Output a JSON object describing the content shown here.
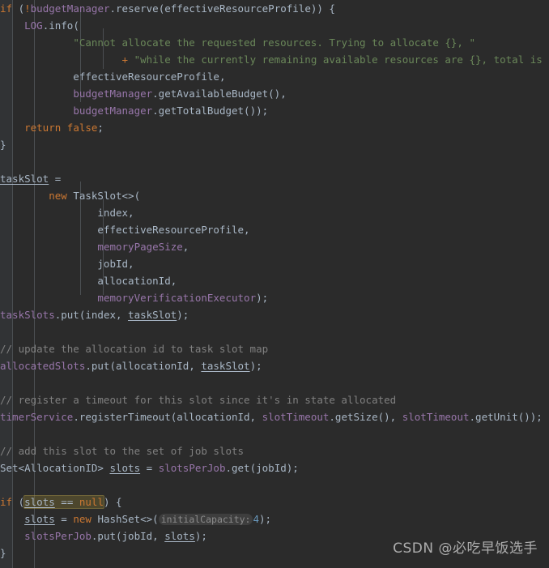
{
  "editor": {
    "background_color": "#2b2b2b",
    "gutter_color": "#313335",
    "default_text_color": "#a9b7c6",
    "font_size_px": 12.5,
    "line_height_px": 21,
    "colors": {
      "keyword": "#cc7832",
      "field": "#9876aa",
      "string": "#6a8759",
      "comment": "#808080",
      "number": "#6897bb",
      "identifier": "#a9b7c6",
      "highlight_box": "rgba(150,130,50,0.32)",
      "inlay_hint": "#8c8c8c"
    }
  },
  "code": {
    "lines": [
      {
        "id": "line-if-budget-reserve",
        "clipped_top": true,
        "tokens": [
          {
            "t": "if",
            "c": "kw"
          },
          {
            "t": " (",
            "c": "plain"
          },
          {
            "t": "!",
            "c": "kw"
          },
          {
            "t": "budgetManager",
            "c": "field"
          },
          {
            "t": ".reserve(effectiveResourceProfile)) {",
            "c": "plain"
          }
        ]
      },
      {
        "id": "line-log-info",
        "tokens": [
          {
            "t": "    ",
            "c": "plain"
          },
          {
            "t": "LOG",
            "c": "field"
          },
          {
            "t": ".info(",
            "c": "plain"
          }
        ]
      },
      {
        "id": "line-string-cannot-allocate",
        "tokens": [
          {
            "t": "            ",
            "c": "plain"
          },
          {
            "t": "\"Cannot allocate the requested resources. Trying to allocate {}, \"",
            "c": "str"
          }
        ]
      },
      {
        "id": "line-string-while-remaining",
        "tokens": [
          {
            "t": "                    ",
            "c": "plain"
          },
          {
            "t": "+ ",
            "c": "kw"
          },
          {
            "t": "\"while the currently remaining available resources are {}, total is ",
            "c": "str"
          }
        ]
      },
      {
        "id": "line-arg-effective-resource-profile",
        "tokens": [
          {
            "t": "            effectiveResourceProfile",
            "c": "plain"
          },
          {
            "t": ",",
            "c": "plain"
          }
        ]
      },
      {
        "id": "line-arg-get-available-budget",
        "tokens": [
          {
            "t": "            ",
            "c": "plain"
          },
          {
            "t": "budgetManager",
            "c": "field"
          },
          {
            "t": ".getAvailableBudget(),",
            "c": "plain"
          }
        ]
      },
      {
        "id": "line-arg-get-total-budget",
        "tokens": [
          {
            "t": "            ",
            "c": "plain"
          },
          {
            "t": "budgetManager",
            "c": "field"
          },
          {
            "t": ".getTotalBudget());",
            "c": "plain"
          }
        ]
      },
      {
        "id": "line-return-false",
        "tokens": [
          {
            "t": "    ",
            "c": "plain"
          },
          {
            "t": "return false",
            "c": "kw"
          },
          {
            "t": ";",
            "c": "plain"
          }
        ]
      },
      {
        "id": "line-close-brace-1",
        "tokens": [
          {
            "t": "}",
            "c": "plain"
          }
        ]
      },
      {
        "id": "line-blank-1",
        "tokens": []
      },
      {
        "id": "line-taskslot-assign",
        "tokens": [
          {
            "t": "taskSlot",
            "c": "localvar"
          },
          {
            "t": " =",
            "c": "plain"
          }
        ]
      },
      {
        "id": "line-new-taskslot",
        "tokens": [
          {
            "t": "        ",
            "c": "plain"
          },
          {
            "t": "new ",
            "c": "kw"
          },
          {
            "t": "TaskSlot<>(",
            "c": "cls"
          }
        ]
      },
      {
        "id": "line-ctor-index",
        "tokens": [
          {
            "t": "                index",
            "c": "plain"
          },
          {
            "t": ",",
            "c": "plain"
          }
        ]
      },
      {
        "id": "line-ctor-effective-resource-profile",
        "tokens": [
          {
            "t": "                effectiveResourceProfile,",
            "c": "plain"
          }
        ]
      },
      {
        "id": "line-ctor-memory-page-size",
        "tokens": [
          {
            "t": "                ",
            "c": "plain"
          },
          {
            "t": "memoryPageSize",
            "c": "field"
          },
          {
            "t": ",",
            "c": "plain"
          }
        ]
      },
      {
        "id": "line-ctor-jobid",
        "tokens": [
          {
            "t": "                jobId",
            "c": "plain"
          },
          {
            "t": ",",
            "c": "plain"
          }
        ]
      },
      {
        "id": "line-ctor-allocationid",
        "tokens": [
          {
            "t": "                allocationId,",
            "c": "plain"
          }
        ]
      },
      {
        "id": "line-ctor-memory-verification-executor",
        "tokens": [
          {
            "t": "                ",
            "c": "plain"
          },
          {
            "t": "memoryVerificationExecutor",
            "c": "field"
          },
          {
            "t": ");",
            "c": "plain"
          }
        ]
      },
      {
        "id": "line-taskslots-put",
        "tokens": [
          {
            "t": "taskSlots",
            "c": "field"
          },
          {
            "t": ".put(index, ",
            "c": "plain"
          },
          {
            "t": "taskSlot",
            "c": "localvar"
          },
          {
            "t": ");",
            "c": "plain"
          }
        ]
      },
      {
        "id": "line-blank-2",
        "tokens": []
      },
      {
        "id": "line-comment-update-allocation",
        "tokens": [
          {
            "t": "// update the allocation id to task slot map",
            "c": "cmt"
          }
        ]
      },
      {
        "id": "line-allocatedslots-put",
        "tokens": [
          {
            "t": "allocatedSlots",
            "c": "field"
          },
          {
            "t": ".put(allocationId, ",
            "c": "plain"
          },
          {
            "t": "taskSlot",
            "c": "localvar"
          },
          {
            "t": ");",
            "c": "plain"
          }
        ]
      },
      {
        "id": "line-blank-3",
        "tokens": []
      },
      {
        "id": "line-comment-register-timeout",
        "tokens": [
          {
            "t": "// register a timeout for this slot since it's in state allocated",
            "c": "cmt"
          }
        ]
      },
      {
        "id": "line-timerservice-register-timeout",
        "tokens": [
          {
            "t": "timerService",
            "c": "field"
          },
          {
            "t": ".registerTimeout(allocationId, ",
            "c": "plain"
          },
          {
            "t": "slotTimeout",
            "c": "field"
          },
          {
            "t": ".getSize(), ",
            "c": "plain"
          },
          {
            "t": "slotTimeout",
            "c": "field"
          },
          {
            "t": ".getUnit());",
            "c": "plain"
          }
        ]
      },
      {
        "id": "line-blank-4",
        "tokens": []
      },
      {
        "id": "line-comment-add-slot",
        "tokens": [
          {
            "t": "// add this slot to the set of job slots",
            "c": "cmt"
          }
        ]
      },
      {
        "id": "line-set-slots-assign",
        "tokens": [
          {
            "t": "Set<AllocationID> ",
            "c": "plain"
          },
          {
            "t": "slots",
            "c": "localvar"
          },
          {
            "t": " = ",
            "c": "plain"
          },
          {
            "t": "slotsPerJob",
            "c": "field"
          },
          {
            "t": ".get(jobId);",
            "c": "plain"
          }
        ]
      },
      {
        "id": "line-blank-5",
        "tokens": []
      },
      {
        "id": "line-if-slots-null",
        "tokens": [
          {
            "t": "if",
            "c": "kw"
          },
          {
            "t": " (",
            "c": "plain"
          },
          {
            "t": "HL_START",
            "c": "marker"
          },
          {
            "t": "slots",
            "c": "localvar"
          },
          {
            "t": " == ",
            "c": "plain"
          },
          {
            "t": "null",
            "c": "kw"
          },
          {
            "t": "HL_END",
            "c": "marker"
          },
          {
            "t": ") {",
            "c": "plain"
          }
        ]
      },
      {
        "id": "line-slots-new-hashset",
        "tokens": [
          {
            "t": "    ",
            "c": "plain"
          },
          {
            "t": "slots",
            "c": "localvar"
          },
          {
            "t": " = ",
            "c": "plain"
          },
          {
            "t": "new ",
            "c": "kw"
          },
          {
            "t": "HashSet<>(",
            "c": "cls"
          },
          {
            "t": "HINT:initialCapacity:",
            "c": "marker"
          },
          {
            "t": "4",
            "c": "num"
          },
          {
            "t": ");",
            "c": "plain"
          }
        ]
      },
      {
        "id": "line-slotsperjob-put",
        "tokens": [
          {
            "t": "    ",
            "c": "plain"
          },
          {
            "t": "slotsPerJob",
            "c": "field"
          },
          {
            "t": ".put(jobId, ",
            "c": "plain"
          },
          {
            "t": "slots",
            "c": "localvar"
          },
          {
            "t": ");",
            "c": "plain"
          }
        ]
      },
      {
        "id": "line-close-brace-2",
        "tokens": [
          {
            "t": "}",
            "c": "plain"
          }
        ]
      }
    ],
    "inlay_hints": [
      {
        "id": "hint-initial-capacity",
        "label": "initialCapacity:"
      }
    ],
    "highlighted_expression": "slots == null"
  },
  "watermark": {
    "text": "CSDN @必吃早饭选手"
  }
}
